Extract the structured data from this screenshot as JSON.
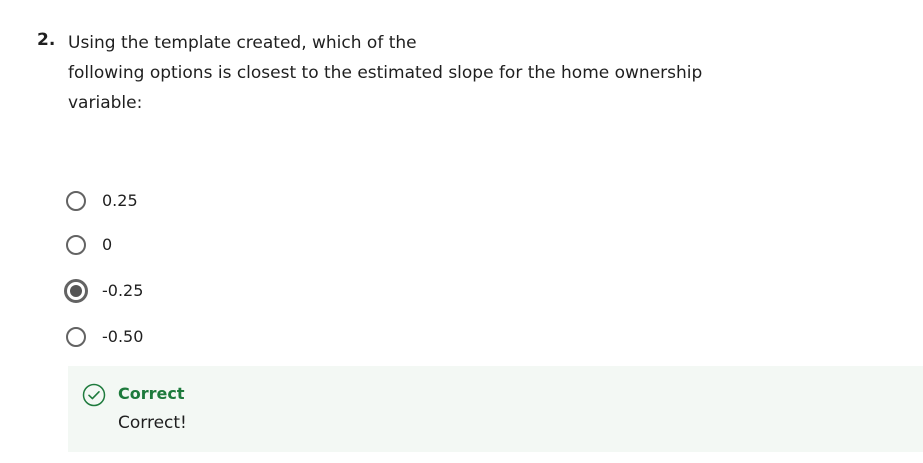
{
  "question": {
    "number": "2.",
    "lines": [
      "Using the template created, which of the",
      "following options is closest to the estimated slope for the home ownership",
      "variable:"
    ]
  },
  "options": [
    {
      "label": "0.25",
      "selected": false
    },
    {
      "label": "0",
      "selected": false
    },
    {
      "label": "-0.25",
      "selected": true
    },
    {
      "label": "-0.50",
      "selected": false
    }
  ],
  "feedback": {
    "status": "Correct",
    "message": "Correct!",
    "icon": "check-circle-icon",
    "accent_color": "#1d7a3c",
    "background_color": "#f3f8f4"
  }
}
